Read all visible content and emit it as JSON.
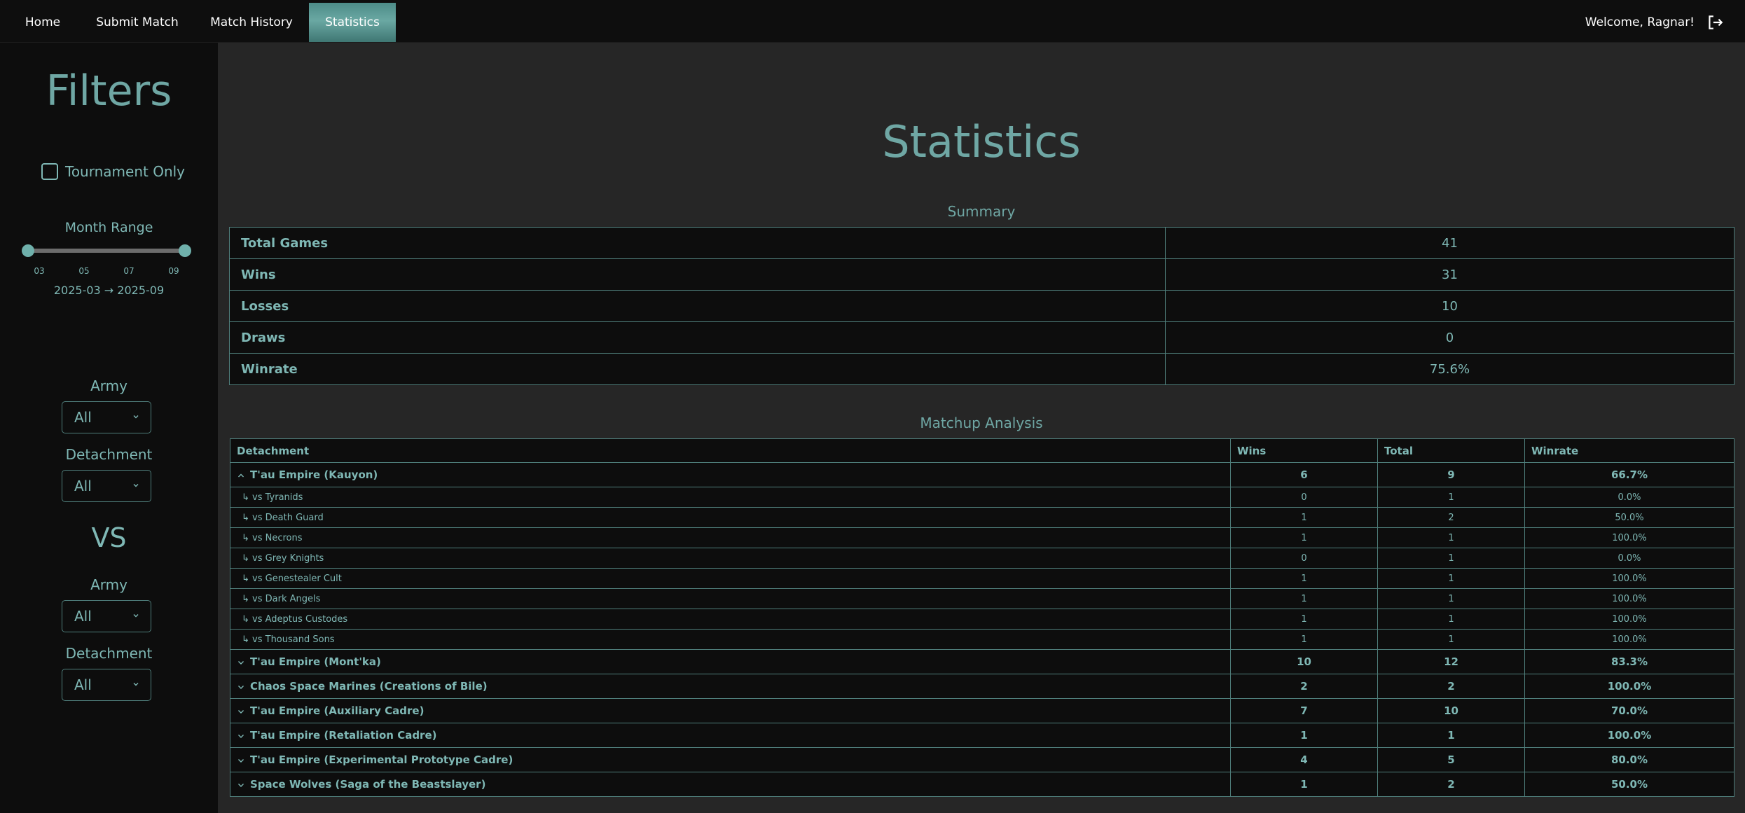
{
  "nav": {
    "items": [
      {
        "label": "Home"
      },
      {
        "label": "Submit Match"
      },
      {
        "label": "Match History"
      },
      {
        "label": "Statistics"
      }
    ],
    "welcome": "Welcome, Ragnar!",
    "logout_icon": "logout-icon"
  },
  "sidebar": {
    "title": "Filters",
    "tournament_label": "Tournament Only",
    "tournament_checked": false,
    "month_range_label": "Month Range",
    "ticks": [
      "03",
      "05",
      "07",
      "09"
    ],
    "range_text": "2025-03 → 2025-09",
    "army_label": "Army",
    "army_value": "All",
    "detachment_label": "Detachment",
    "detachment_value": "All",
    "vs_label": "VS",
    "opp_army_label": "Army",
    "opp_army_value": "All",
    "opp_detachment_label": "Detachment",
    "opp_detachment_value": "All"
  },
  "main": {
    "title": "Statistics",
    "summary_title": "Summary",
    "summary": [
      {
        "label": "Total Games",
        "value": "41"
      },
      {
        "label": "Wins",
        "value": "31"
      },
      {
        "label": "Losses",
        "value": "10"
      },
      {
        "label": "Draws",
        "value": "0"
      },
      {
        "label": "Winrate",
        "value": "75.6%"
      }
    ],
    "matchup_title": "Matchup Analysis",
    "matchup_headers": {
      "detachment": "Detachment",
      "wins": "Wins",
      "total": "Total",
      "winrate": "Winrate"
    },
    "matchup_rows": [
      {
        "type": "parent",
        "expanded": true,
        "name": "T'au Empire (Kauyon)",
        "wins": "6",
        "total": "9",
        "winrate": "66.7%"
      },
      {
        "type": "child",
        "name": "↳ vs Tyranids",
        "wins": "0",
        "total": "1",
        "winrate": "0.0%"
      },
      {
        "type": "child",
        "name": "↳ vs Death Guard",
        "wins": "1",
        "total": "2",
        "winrate": "50.0%"
      },
      {
        "type": "child",
        "name": "↳ vs Necrons",
        "wins": "1",
        "total": "1",
        "winrate": "100.0%"
      },
      {
        "type": "child",
        "name": "↳ vs Grey Knights",
        "wins": "0",
        "total": "1",
        "winrate": "0.0%"
      },
      {
        "type": "child",
        "name": "↳ vs Genestealer Cult",
        "wins": "1",
        "total": "1",
        "winrate": "100.0%"
      },
      {
        "type": "child",
        "name": "↳ vs Dark Angels",
        "wins": "1",
        "total": "1",
        "winrate": "100.0%"
      },
      {
        "type": "child",
        "name": "↳ vs Adeptus Custodes",
        "wins": "1",
        "total": "1",
        "winrate": "100.0%"
      },
      {
        "type": "child",
        "name": "↳ vs Thousand Sons",
        "wins": "1",
        "total": "1",
        "winrate": "100.0%"
      },
      {
        "type": "parent",
        "expanded": false,
        "name": "T'au Empire (Mont'ka)",
        "wins": "10",
        "total": "12",
        "winrate": "83.3%"
      },
      {
        "type": "parent",
        "expanded": false,
        "name": "Chaos Space Marines (Creations of Bile)",
        "wins": "2",
        "total": "2",
        "winrate": "100.0%"
      },
      {
        "type": "parent",
        "expanded": false,
        "name": "T'au Empire (Auxiliary Cadre)",
        "wins": "7",
        "total": "10",
        "winrate": "70.0%"
      },
      {
        "type": "parent",
        "expanded": false,
        "name": "T'au Empire (Retaliation Cadre)",
        "wins": "1",
        "total": "1",
        "winrate": "100.0%"
      },
      {
        "type": "parent",
        "expanded": false,
        "name": "T'au Empire (Experimental Prototype Cadre)",
        "wins": "4",
        "total": "5",
        "winrate": "80.0%"
      },
      {
        "type": "parent",
        "expanded": false,
        "name": "Space Wolves (Saga of the Beastslayer)",
        "wins": "1",
        "total": "2",
        "winrate": "50.0%"
      }
    ]
  }
}
